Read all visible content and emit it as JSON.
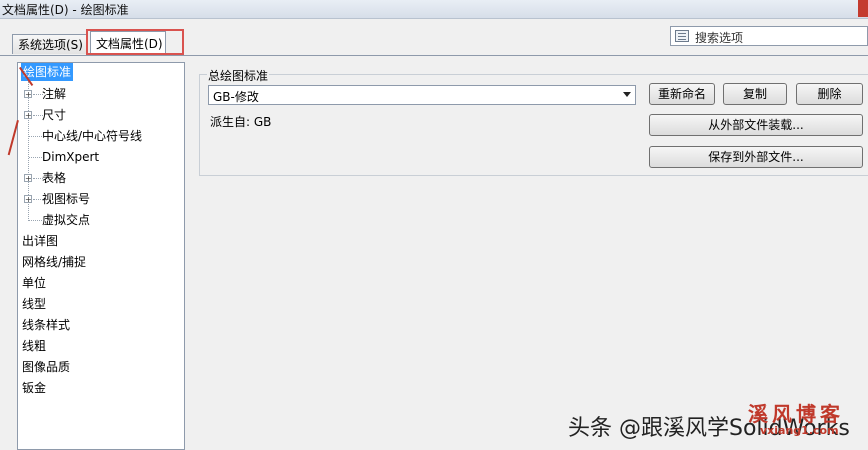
{
  "window": {
    "title": "文档属性(D) - 绘图标准"
  },
  "tabs": [
    {
      "label": "系统选项(S)"
    },
    {
      "label": "文档属性(D)"
    }
  ],
  "search": {
    "label": "搜索选项"
  },
  "tree": {
    "items": [
      {
        "label": "绘图标准"
      },
      {
        "label": "注解"
      },
      {
        "label": "尺寸"
      },
      {
        "label": "中心线/中心符号线"
      },
      {
        "label": "DimXpert"
      },
      {
        "label": "表格"
      },
      {
        "label": "视图标号"
      },
      {
        "label": "虚拟交点"
      },
      {
        "label": "出详图"
      },
      {
        "label": "网格线/捕捉"
      },
      {
        "label": "单位"
      },
      {
        "label": "线型"
      },
      {
        "label": "线条样式"
      },
      {
        "label": "线粗"
      },
      {
        "label": "图像品质"
      },
      {
        "label": "钣金"
      }
    ]
  },
  "standard": {
    "group_label": "总绘图标准",
    "selected": "GB-修改",
    "derived_from": "派生自: GB",
    "rename_button": "重新命名",
    "copy_button": "复制",
    "delete_button": "删除",
    "load_button": "从外部文件装载...",
    "save_button": "保存到外部文件..."
  },
  "watermark": {
    "text": "头条 @跟溪风学SolidWorks",
    "stamp": "溪风博客",
    "stamp_url": "vxiang1.com"
  }
}
